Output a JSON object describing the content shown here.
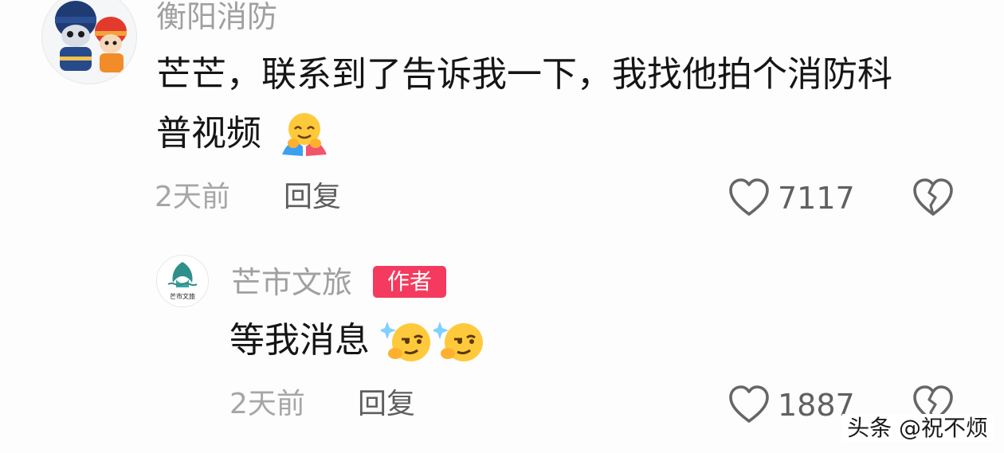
{
  "comments": [
    {
      "user": "衡阳消防",
      "text_line1": "芒芒，联系到了告诉我一下，我找他拍个消防科",
      "text_line2": "普视频",
      "emoji": "hugging-face-emoji",
      "time": "2天前",
      "reply_label": "回复",
      "likes": "7117",
      "avatar_icon": "firefighter-cartoon-avatar"
    },
    {
      "user": "芒市文旅",
      "badge": "作者",
      "text": "等我消息",
      "emoji": "thinking-face-with-sparkles-emoji",
      "time": "2天前",
      "reply_label": "回复",
      "likes": "1887",
      "avatar_logo_text": "芒市文旅"
    }
  ],
  "icons": {
    "like": "heart-outline-icon",
    "dislike": "broken-heart-icon"
  },
  "watermark": "头条 @祝不烦",
  "colors": {
    "author_badge": "#f43a5e",
    "username": "#a0a0a0",
    "comment_text": "#151515",
    "meta": "#a6a6a6",
    "icon": "#666666"
  }
}
